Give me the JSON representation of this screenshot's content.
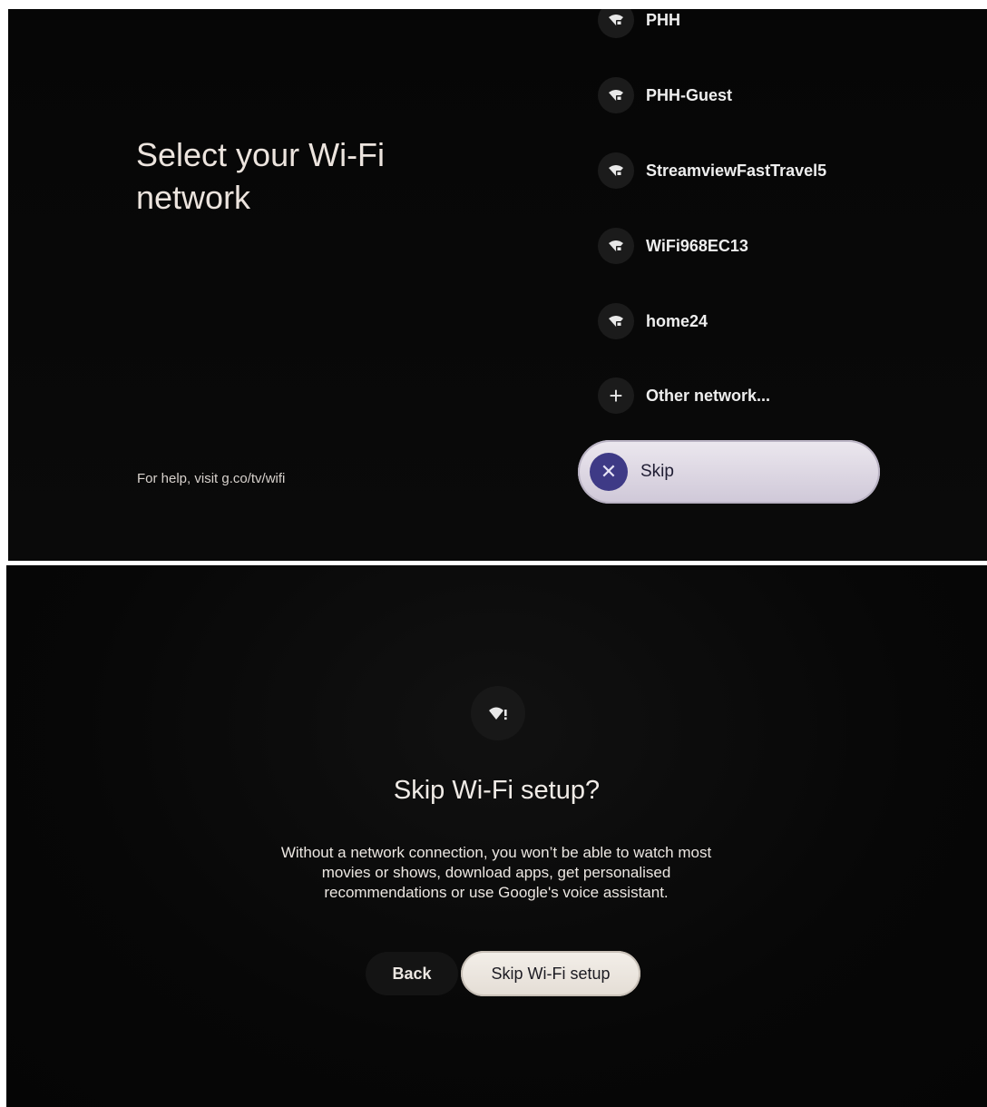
{
  "wifi_select": {
    "title": "Select your Wi-Fi network",
    "help_text": "For help, visit g.co/tv/wifi",
    "networks": [
      {
        "name": "PHH",
        "icon": "wifi-lock-icon"
      },
      {
        "name": "PHH-Guest",
        "icon": "wifi-lock-icon"
      },
      {
        "name": "StreamviewFastTravel5",
        "icon": "wifi-lock-icon"
      },
      {
        "name": "WiFi968EC13",
        "icon": "wifi-lock-icon"
      },
      {
        "name": "home24",
        "icon": "wifi-lock-icon"
      }
    ],
    "other_network": {
      "label": "Other network...",
      "icon": "plus-icon"
    },
    "skip": {
      "label": "Skip",
      "icon": "close-icon",
      "accent": "#3e3a86"
    }
  },
  "skip_dialog": {
    "icon": "wifi-alert-icon",
    "title": "Skip Wi-Fi setup?",
    "body": "Without a network connection, you won’t be able to watch most movies or shows, download apps, get personalised recommendations or use Google's voice assistant.",
    "back_label": "Back",
    "confirm_label": "Skip Wi-Fi setup"
  }
}
